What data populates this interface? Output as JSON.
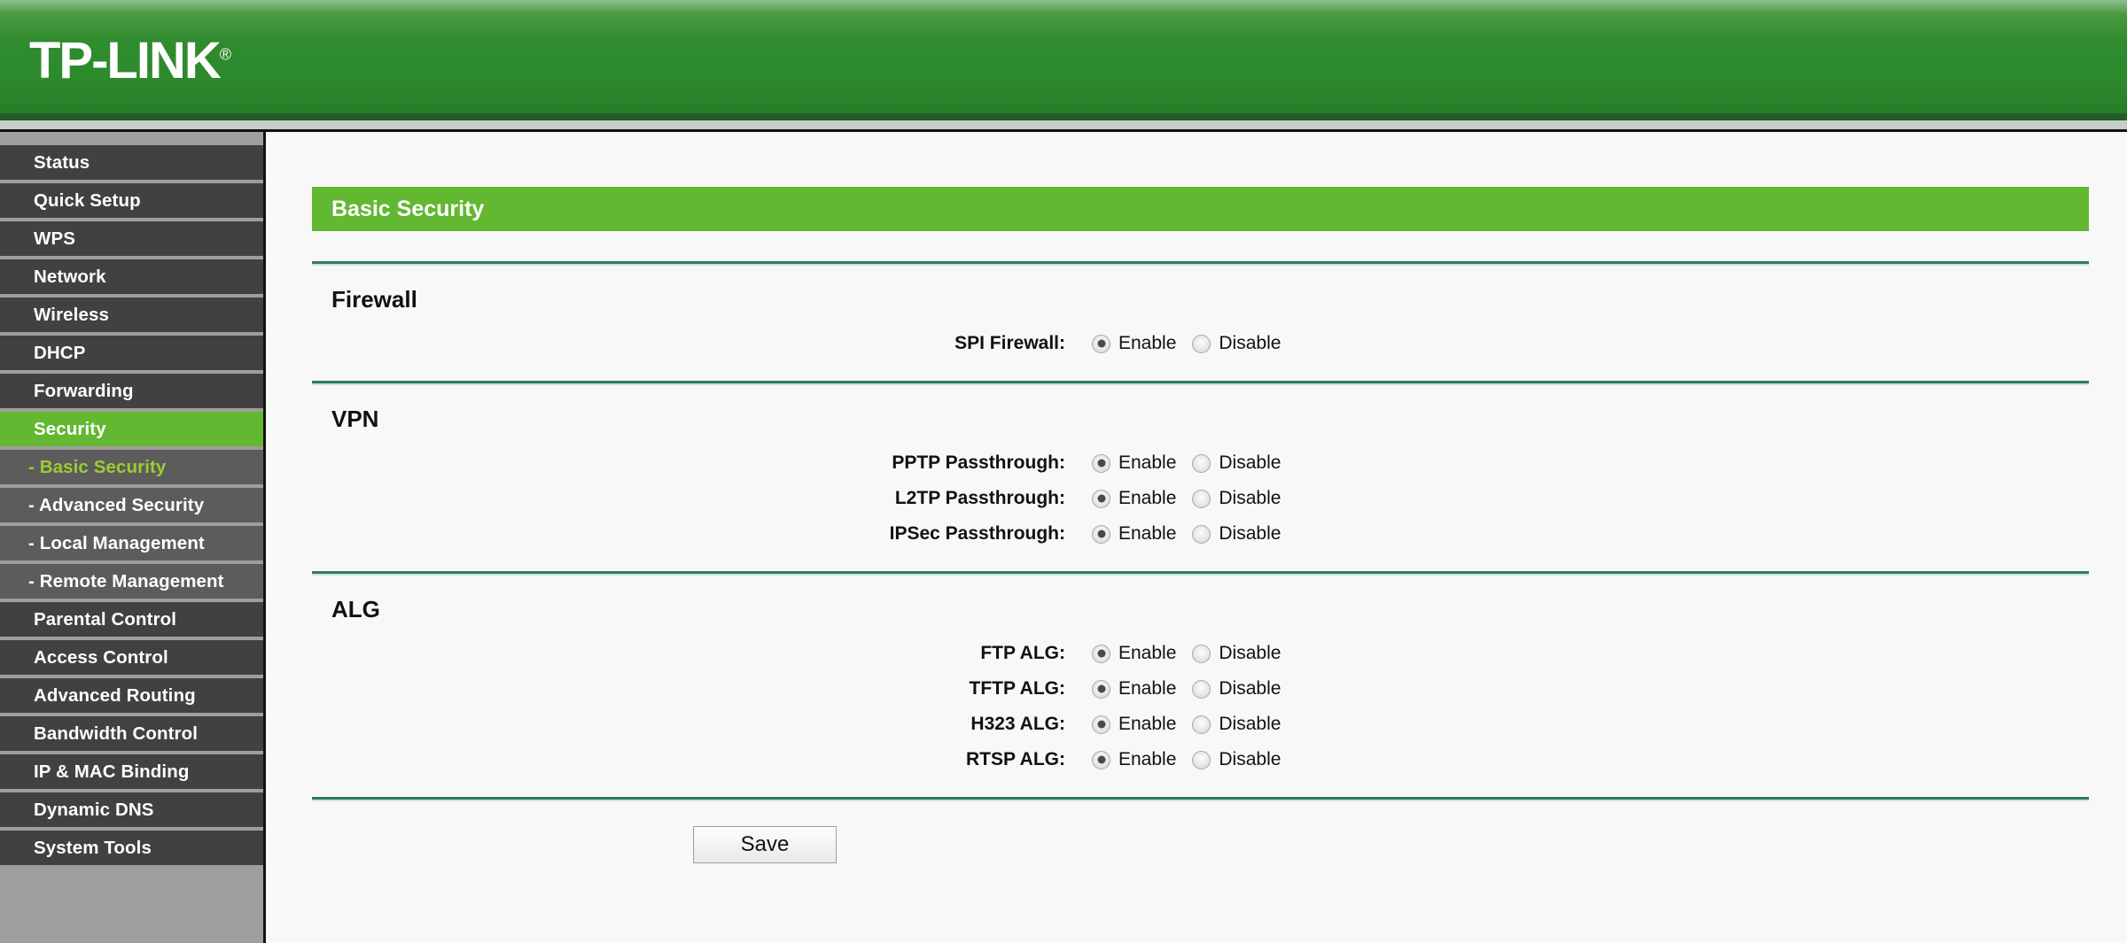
{
  "brand": {
    "logo_text": "TP-LINK",
    "registered_mark": "®"
  },
  "sidebar": {
    "items": [
      {
        "label": "Status",
        "type": "top",
        "state": "normal"
      },
      {
        "label": "Quick Setup",
        "type": "top",
        "state": "normal"
      },
      {
        "label": "WPS",
        "type": "top",
        "state": "normal"
      },
      {
        "label": "Network",
        "type": "top",
        "state": "normal"
      },
      {
        "label": "Wireless",
        "type": "top",
        "state": "normal"
      },
      {
        "label": "DHCP",
        "type": "top",
        "state": "normal"
      },
      {
        "label": "Forwarding",
        "type": "top",
        "state": "normal"
      },
      {
        "label": "Security",
        "type": "top",
        "state": "active"
      },
      {
        "label": "- Basic Security",
        "type": "sub",
        "state": "current"
      },
      {
        "label": "- Advanced Security",
        "type": "sub",
        "state": "normal"
      },
      {
        "label": "- Local Management",
        "type": "sub",
        "state": "normal"
      },
      {
        "label": "- Remote Management",
        "type": "sub",
        "state": "normal"
      },
      {
        "label": "Parental Control",
        "type": "top",
        "state": "normal"
      },
      {
        "label": "Access Control",
        "type": "top",
        "state": "normal"
      },
      {
        "label": "Advanced Routing",
        "type": "top",
        "state": "normal"
      },
      {
        "label": "Bandwidth Control",
        "type": "top",
        "state": "normal"
      },
      {
        "label": "IP & MAC Binding",
        "type": "top",
        "state": "normal"
      },
      {
        "label": "Dynamic DNS",
        "type": "top",
        "state": "normal"
      },
      {
        "label": "System Tools",
        "type": "top",
        "state": "normal"
      }
    ]
  },
  "page": {
    "title": "Basic Security"
  },
  "options": {
    "enable": "Enable",
    "disable": "Disable"
  },
  "sections": {
    "firewall": {
      "heading": "Firewall",
      "fields": [
        {
          "label": "SPI Firewall:",
          "value": "Enable"
        }
      ]
    },
    "vpn": {
      "heading": "VPN",
      "fields": [
        {
          "label": "PPTP Passthrough:",
          "value": "Enable"
        },
        {
          "label": "L2TP Passthrough:",
          "value": "Enable"
        },
        {
          "label": "IPSec Passthrough:",
          "value": "Enable"
        }
      ]
    },
    "alg": {
      "heading": "ALG",
      "fields": [
        {
          "label": "FTP ALG:",
          "value": "Enable"
        },
        {
          "label": "TFTP ALG:",
          "value": "Enable"
        },
        {
          "label": "H323 ALG:",
          "value": "Enable"
        },
        {
          "label": "RTSP ALG:",
          "value": "Enable"
        }
      ]
    }
  },
  "actions": {
    "save_label": "Save"
  },
  "colors": {
    "brand_green": "#2d8a2d",
    "accent_green": "#62b830",
    "sidebar_bg": "#9e9e9e",
    "menu_bg": "#414141",
    "menu_sub_bg": "#5c5c5c",
    "sub_current_text": "#9acd32",
    "divider_green": "#2e7d5b"
  }
}
